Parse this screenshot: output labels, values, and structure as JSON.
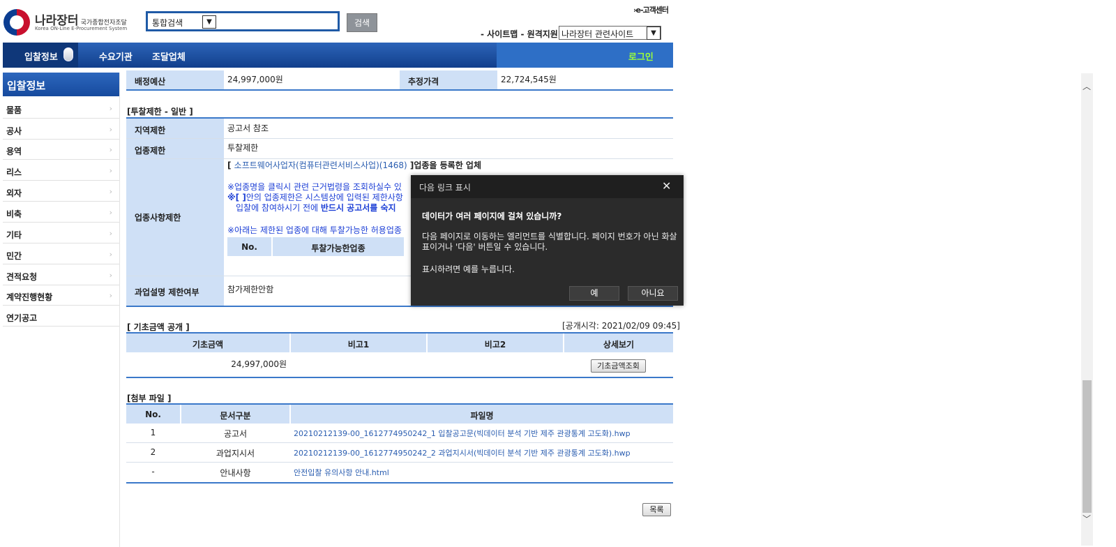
{
  "header": {
    "logo_title": "나라장터",
    "logo_subtitle": "국가종합전자조달",
    "logo_english": "Korea ON-Line E-Procurement System",
    "search_select_value": "통합검색",
    "search_button": "검색",
    "ecenter_link": "›e-고객센터",
    "top_links": "- 사이트맵 - 원격지원",
    "site_select_value": "나라장터 관련사이트"
  },
  "nav": {
    "items": [
      "입찰정보",
      "수요기관",
      "조달업체"
    ],
    "login": "로그인"
  },
  "sidebar": {
    "title": "입찰정보",
    "items": [
      {
        "label": "물품",
        "has_arrow": true
      },
      {
        "label": "공사",
        "has_arrow": true
      },
      {
        "label": "용역",
        "has_arrow": true
      },
      {
        "label": "리스",
        "has_arrow": true
      },
      {
        "label": "외자",
        "has_arrow": true
      },
      {
        "label": "비축",
        "has_arrow": true
      },
      {
        "label": "기타",
        "has_arrow": true
      },
      {
        "label": "민간",
        "has_arrow": true
      },
      {
        "label": "견적요청",
        "has_arrow": true
      },
      {
        "label": "계약진행현황",
        "has_arrow": true
      },
      {
        "label": "연기공고",
        "has_arrow": false
      }
    ]
  },
  "budget": {
    "label1": "배정예산",
    "value1": "24,997,000원",
    "label2": "추정가격",
    "value2": "22,724,545원"
  },
  "restriction": {
    "title": "[투찰제한 - 일반 ]",
    "region_label": "지역제한",
    "region_value": "공고서 참조",
    "industry_label": "업종제한",
    "industry_value": "투찰제한",
    "items_label": "업종사항제한",
    "bracket_open": "[ ",
    "industry_link": "소프트웨어사업자(컴퓨터관련서비스사업)(1468)",
    "bracket_close": " ]업종을 등록한 업체",
    "notice1": "※업종명을 클릭시 관련 근거법령을 조회하실수 있",
    "notice2a": "※[ ]",
    "notice2b": "안의 업종제한은 시스템상에 입력된 제한사항",
    "notice3a": "입찰에 참여하시기 전에 ",
    "notice3b": "반드시 공고서를 숙지",
    "notice4": "※아래는 제한된 업종에 대해 투찰가능한 허용업종",
    "sub_header_no": "No.",
    "sub_header_industry": "투찰가능한업종",
    "briefing_label": "과업설명 제한여부",
    "briefing_value": "참가제한안함"
  },
  "base_amount": {
    "title": "[ 기초금액 공개 ]",
    "open_time": "[공개시각: 2021/02/09 09:45]",
    "headers": [
      "기초금액",
      "비고1",
      "비고2",
      "상세보기"
    ],
    "amount": "24,997,000원",
    "note1": "",
    "note2": "",
    "button": "기초금액조회"
  },
  "attachments": {
    "title": "[첨부 파일 ]",
    "headers": [
      "No.",
      "문서구분",
      "파일명"
    ],
    "rows": [
      {
        "no": "1",
        "type": "공고서",
        "file": "20210212139-00_1612774950242_1 입찰공고문(빅데이터 분석 기반 제주 관광통계 고도화).hwp"
      },
      {
        "no": "2",
        "type": "과업지시서",
        "file": "20210212139-00_1612774950242_2 과업지시서(빅데이터 분석 기반 제주 관광통계 고도화).hwp"
      },
      {
        "no": "-",
        "type": "안내사항",
        "file": "안전입찰 유의사항 안내.html"
      }
    ],
    "list_button": "목록"
  },
  "dialog": {
    "title": "다음 링크 표시",
    "question": "데이터가 여러 페이지에 걸쳐 있습니까?",
    "description": "다음 페이지로 이동하는 엘리먼트를 식별합니다. 페이지 번호가 아닌 화살표이거나 '다음' 버튼일 수 있습니다.",
    "prompt": "표시하려면 예를 누릅니다.",
    "yes": "예",
    "no": "아니요"
  },
  "colors": {
    "nav_blue": "#1a4f9f",
    "header_cell": "#cfe0f6",
    "link": "#2a5db0",
    "notice_blue": "#1c3fd6",
    "login_green": "#9cff3a",
    "dialog_bg": "#2b2b2b"
  }
}
